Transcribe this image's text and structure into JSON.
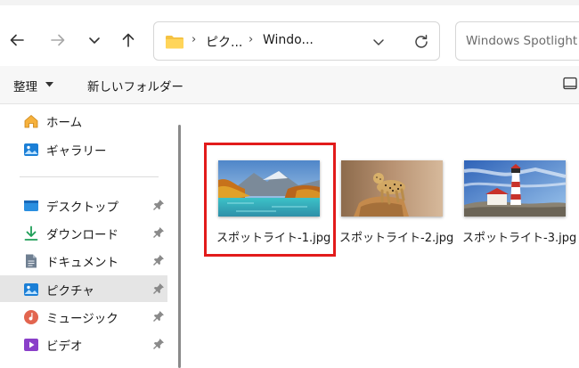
{
  "nav": {
    "back_icon": "arrow-left-icon",
    "forward_icon": "arrow-right-icon",
    "recent_icon": "chevron-down-icon",
    "up_icon": "arrow-up-icon"
  },
  "address": {
    "folder_icon": "folder-icon",
    "crumbs": [
      "ピク...",
      "Windo..."
    ],
    "dropdown_icon": "chevron-down-icon",
    "refresh_icon": "refresh-icon"
  },
  "search": {
    "placeholder": "Windows Spotlight"
  },
  "toolbar": {
    "organize_label": "整理",
    "new_folder_label": "新しいフォルダー",
    "view_icon": "view-layout-icon"
  },
  "sidebar": {
    "items": [
      {
        "label": "ホーム",
        "icon": "home-icon",
        "pinned": false,
        "selected": false
      },
      {
        "label": "ギャラリー",
        "icon": "gallery-icon",
        "pinned": false,
        "selected": false
      },
      {
        "label": "デスクトップ",
        "icon": "desktop-icon",
        "pinned": true,
        "selected": false
      },
      {
        "label": "ダウンロード",
        "icon": "download-icon",
        "pinned": true,
        "selected": false
      },
      {
        "label": "ドキュメント",
        "icon": "document-icon",
        "pinned": true,
        "selected": false
      },
      {
        "label": "ピクチャ",
        "icon": "pictures-icon",
        "pinned": true,
        "selected": true
      },
      {
        "label": "ミュージック",
        "icon": "music-icon",
        "pinned": true,
        "selected": false
      },
      {
        "label": "ビデオ",
        "icon": "video-icon",
        "pinned": true,
        "selected": false
      }
    ]
  },
  "files": [
    {
      "name": "スポットライト-1.jpg",
      "highlighted": true
    },
    {
      "name": "スポットライト-2.jpg",
      "highlighted": false
    },
    {
      "name": "スポットライト-3.jpg",
      "highlighted": false
    }
  ],
  "colors": {
    "highlight": "#e21b1b",
    "selected_bg": "#e5e5e5",
    "accent": "#0067c0"
  }
}
